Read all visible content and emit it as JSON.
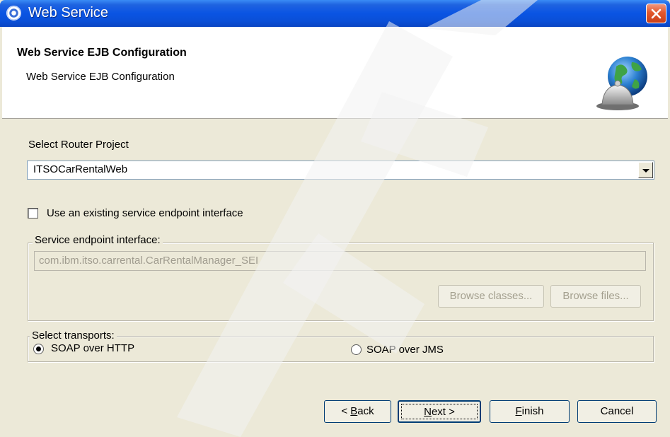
{
  "window": {
    "title": "Web Service"
  },
  "header": {
    "title": "Web Service EJB Configuration",
    "description": "Web Service EJB Configuration"
  },
  "router": {
    "label": "Select Router Project",
    "selected": "ITSOCarRentalWeb"
  },
  "sei": {
    "checkbox_label": "Use an existing service endpoint interface",
    "checked": false,
    "group_label": "Service endpoint interface:",
    "value": "com.ibm.itso.carrental.CarRentalManager_SEI",
    "browse_classes": "Browse classes...",
    "browse_files": "Browse files..."
  },
  "transports": {
    "group_label": "Select transports:",
    "options": [
      {
        "label": "SOAP over HTTP",
        "selected": true
      },
      {
        "label": "SOAP over JMS",
        "selected": false
      }
    ]
  },
  "buttons": {
    "back": "< Back",
    "next": "Next >",
    "finish": "Finish",
    "cancel": "Cancel"
  },
  "colors": {
    "titlebar": "#0a54e3",
    "dialog_bg": "#ece9d8",
    "watermark": "#f2f2f2"
  }
}
